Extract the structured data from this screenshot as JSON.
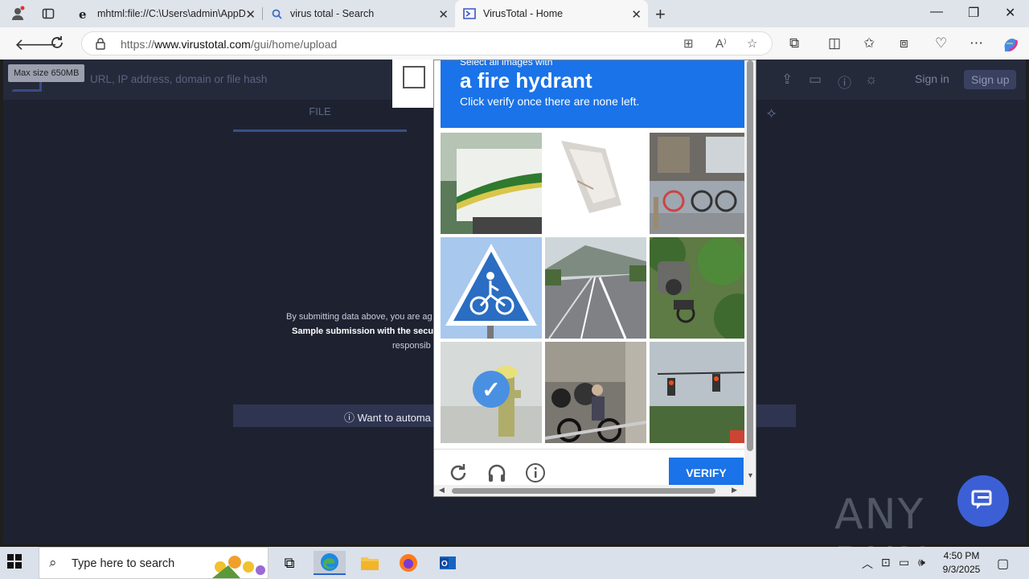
{
  "browser": {
    "tabs": [
      {
        "title": "mhtml:file://C:\\Users\\admin\\AppD",
        "favicon": "ie-icon"
      },
      {
        "title": "virus total - Search",
        "favicon": "search-icon"
      },
      {
        "title": "VirusTotal - Home",
        "favicon": "virustotal-icon"
      }
    ],
    "url_prefix": "https://",
    "url_domain": "www.virustotal.com",
    "url_path": "/gui/home/upload"
  },
  "virustotal": {
    "max_size_tooltip": "Max size 650MB",
    "search_placeholder": "URL, IP address, domain or file hash",
    "sign_in": "Sign in",
    "sign_up": "Sign up",
    "file_tab": "FILE",
    "terms_line1": "By submitting data above, you are ag",
    "terms_line2": "Sample submission with the secu",
    "terms_line3": "responsib",
    "automate_text": "ⓘ Want to automa"
  },
  "captcha": {
    "prompt_small": "Select all images with",
    "target": "a fire hydrant",
    "instruction": "Click verify once there are none left.",
    "verify_label": "VERIFY",
    "tiles": [
      {
        "subject": "bus",
        "selected": false
      },
      {
        "subject": "sign-fragment",
        "selected": false
      },
      {
        "subject": "bicycles",
        "selected": false
      },
      {
        "subject": "bicycle-sign",
        "selected": false
      },
      {
        "subject": "road",
        "selected": false
      },
      {
        "subject": "motorcycle-bushes",
        "selected": false
      },
      {
        "subject": "fire-hydrant",
        "selected": true
      },
      {
        "subject": "motorcycles",
        "selected": false
      },
      {
        "subject": "traffic-lights",
        "selected": false
      }
    ]
  },
  "watermark": "ANY RUN",
  "taskbar": {
    "search_placeholder": "Type here to search",
    "time": "4:50 PM",
    "date": "9/3/2025"
  }
}
